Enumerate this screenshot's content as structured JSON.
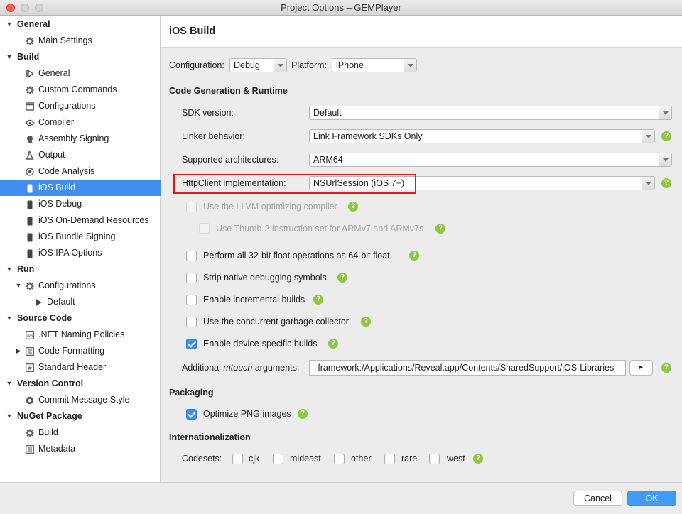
{
  "window": {
    "title": "Project Options – GEMPlayer"
  },
  "sidebar": {
    "items": [
      {
        "label": "General",
        "type": "cat"
      },
      {
        "label": "Main Settings",
        "icon": "gear-icon"
      },
      {
        "label": "Build",
        "type": "cat"
      },
      {
        "label": "General",
        "icon": "build-general-icon"
      },
      {
        "label": "Custom Commands",
        "icon": "gear-icon"
      },
      {
        "label": "Configurations",
        "icon": "window-icon"
      },
      {
        "label": "Compiler",
        "icon": "compiler-icon"
      },
      {
        "label": "Assembly Signing",
        "icon": "seal-icon"
      },
      {
        "label": "Output",
        "icon": "flask-icon"
      },
      {
        "label": "Code Analysis",
        "icon": "target-icon"
      },
      {
        "label": "iOS Build",
        "icon": "phone-icon",
        "selected": true
      },
      {
        "label": "iOS Debug",
        "icon": "phone-icon"
      },
      {
        "label": "iOS On-Demand Resources",
        "icon": "phone-icon"
      },
      {
        "label": "iOS Bundle Signing",
        "icon": "phone-icon"
      },
      {
        "label": "iOS IPA Options",
        "icon": "phone-icon"
      },
      {
        "label": "Run",
        "type": "cat"
      },
      {
        "label": "Configurations",
        "icon": "gear-icon"
      },
      {
        "label": "Default",
        "icon": "play-icon"
      },
      {
        "label": "Source Code",
        "type": "cat"
      },
      {
        "label": ".NET Naming Policies",
        "icon": "naming-icon"
      },
      {
        "label": "Code Formatting",
        "icon": "format-icon"
      },
      {
        "label": "Standard Header",
        "icon": "header-icon"
      },
      {
        "label": "Version Control",
        "type": "cat"
      },
      {
        "label": "Commit Message Style",
        "icon": "commit-icon"
      },
      {
        "label": "NuGet Package",
        "type": "cat"
      },
      {
        "label": "Build",
        "icon": "gear-icon"
      },
      {
        "label": "Metadata",
        "icon": "list-icon"
      }
    ]
  },
  "main": {
    "title": "iOS Build",
    "configuration_label": "Configuration:",
    "configuration_value": "Debug",
    "platform_label": "Platform:",
    "platform_value": "iPhone",
    "codegen_section": "Code Generation & Runtime",
    "sdk_label": "SDK version:",
    "sdk_value": "Default",
    "linker_label": "Linker behavior:",
    "linker_value": "Link Framework SDKs Only",
    "arch_label": "Supported architectures:",
    "arch_value": "ARM64",
    "httpclient_label": "HttpClient implementation:",
    "httpclient_value": "NSUrlSession (iOS 7+)",
    "llvm_label": "Use the LLVM optimizing compiler",
    "thumb_label": "Use Thumb-2 instruction set for ARMv7 and ARMv7s",
    "float_label": "Perform all 32-bit float operations as 64-bit float.",
    "strip_label": "Strip native debugging symbols",
    "incremental_label": "Enable incremental builds",
    "concurrent_gc_label": "Use the concurrent garbage collector",
    "device_builds_label": "Enable device-specific builds",
    "mtouch_label_prefix": "Additional ",
    "mtouch_label_em": "mtouch",
    "mtouch_label_suffix": " arguments:",
    "mtouch_value": "--framework:/Applications/Reveal.app/Contents/SharedSupport/iOS-Libraries",
    "mtouch_button": "▸",
    "packaging_section": "Packaging",
    "optimize_png_label": "Optimize PNG images",
    "i18n_section": "Internationalization",
    "codesets_label": "Codesets:",
    "codesets": [
      "cjk",
      "mideast",
      "other",
      "rare",
      "west"
    ],
    "help_glyph": "?"
  },
  "footer": {
    "cancel_label": "Cancel",
    "ok_label": "OK"
  },
  "colors": {
    "accent": "#3f8ef0",
    "help": "#8dc63f",
    "highlight": "#e3161c"
  }
}
